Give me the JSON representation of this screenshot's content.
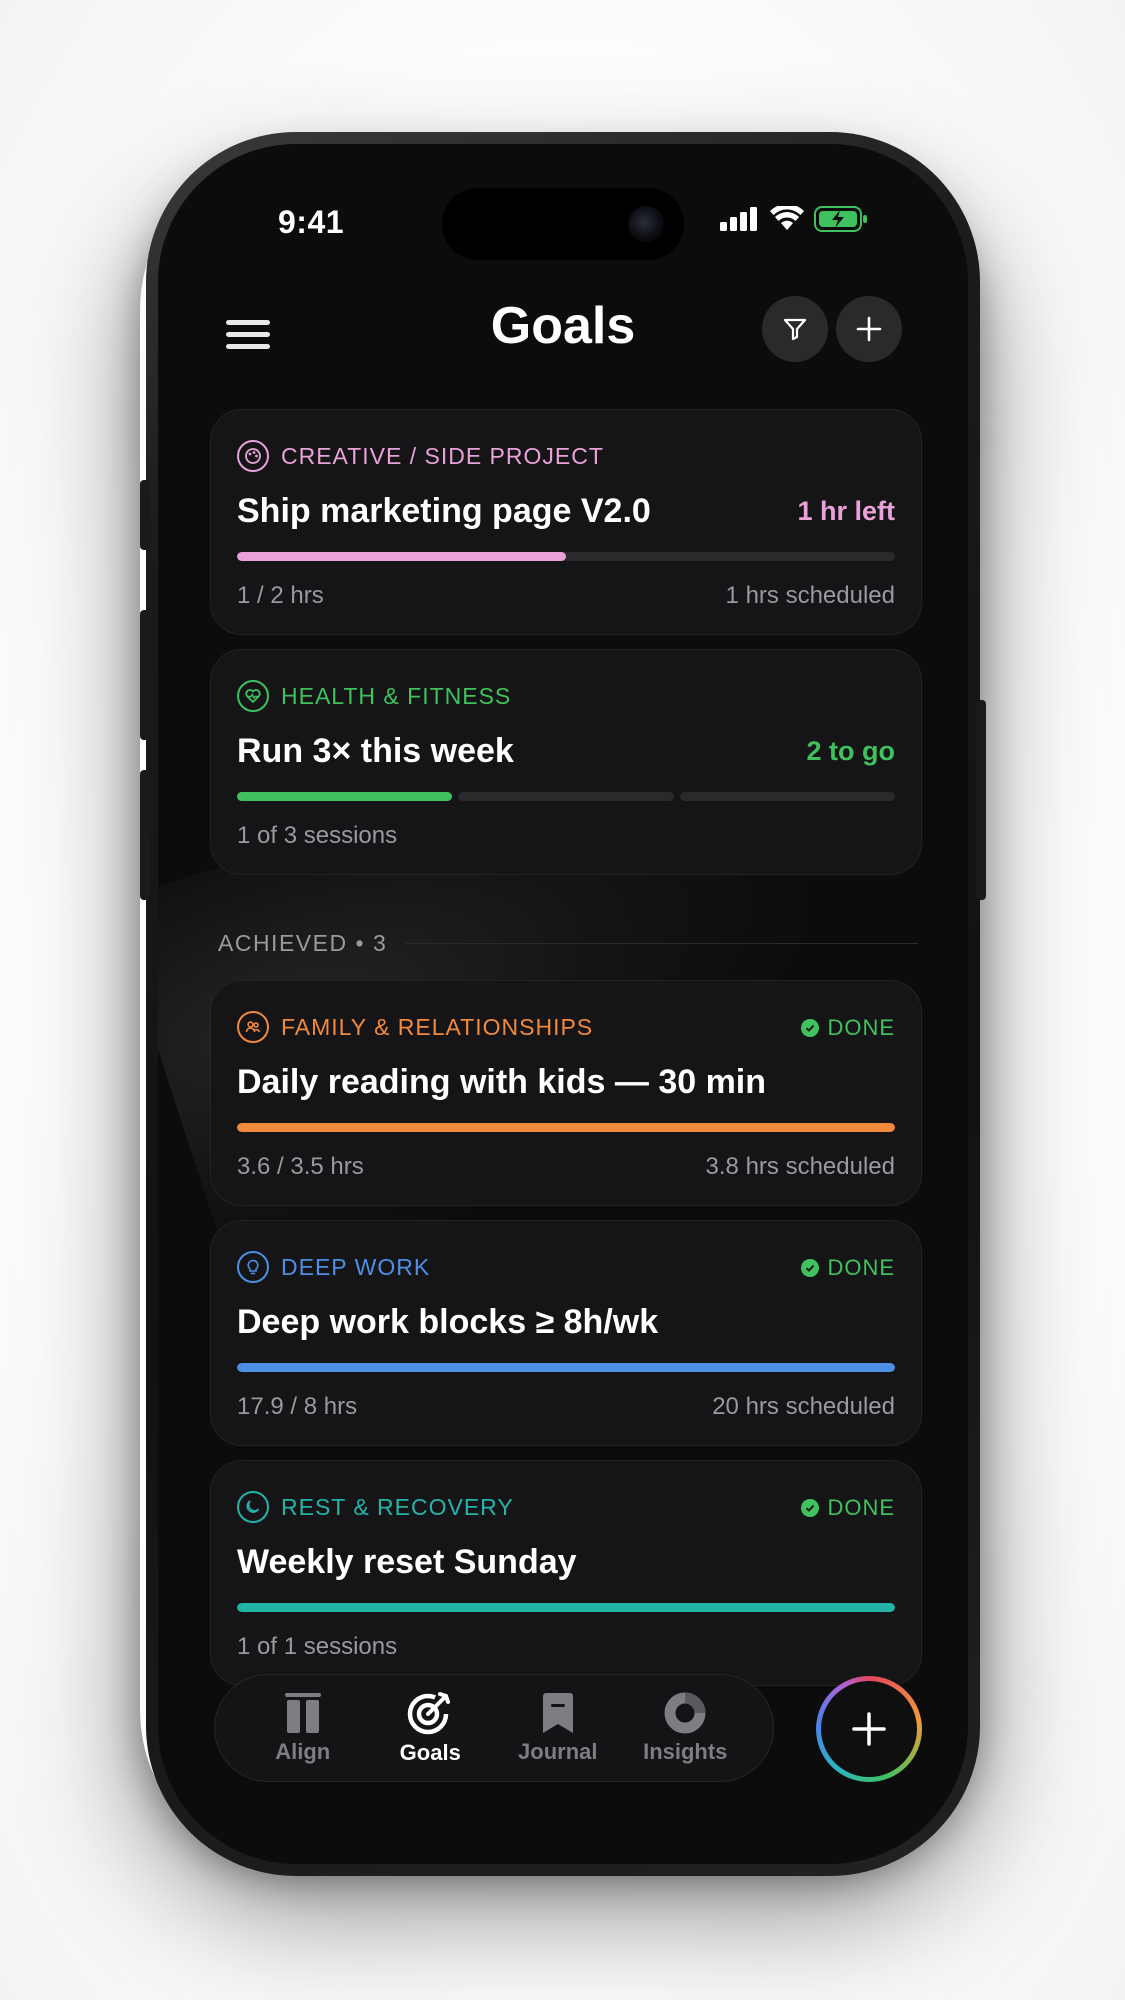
{
  "status": {
    "time": "9:41"
  },
  "header": {
    "title": "Goals",
    "menu_icon": "hamburger-icon",
    "filter_icon": "filter-icon",
    "add_icon": "plus-icon"
  },
  "active_goals": [
    {
      "category": "CREATIVE / SIDE PROJECT",
      "category_icon": "palette-icon",
      "color": "#e9a2d8",
      "title": "Ship marketing page V2.0",
      "right_label": "1 hr left",
      "progress": 0.5,
      "meta_left": "1 / 2 hrs",
      "meta_right": "1 hrs scheduled"
    },
    {
      "category": "HEALTH & FITNESS",
      "category_icon": "heart-pulse-icon",
      "color": "#3fc25e",
      "title": "Run 3× this week",
      "right_label": "2 to go",
      "sessions_done": 1,
      "sessions_total": 3,
      "meta_left": "1 of 3 sessions"
    }
  ],
  "achieved_section": {
    "label": "ACHIEVED",
    "separator": "•",
    "count": "3"
  },
  "achieved_goals": [
    {
      "category": "FAMILY & RELATIONSHIPS",
      "category_icon": "people-icon",
      "color": "#f2893b",
      "done_label": "DONE",
      "title": "Daily reading with kids — 30 min",
      "progress": 1.0,
      "meta_left": "3.6 / 3.5 hrs",
      "meta_right": "3.8 hrs scheduled"
    },
    {
      "category": "DEEP WORK",
      "category_icon": "lightbulb-icon",
      "color": "#4d8fe6",
      "done_label": "DONE",
      "title": "Deep work blocks ≥ 8h/wk",
      "progress": 1.0,
      "meta_left": "17.9 / 8 hrs",
      "meta_right": "20 hrs scheduled"
    },
    {
      "category": "REST & RECOVERY",
      "category_icon": "moon-icon",
      "color": "#24b3a8",
      "done_label": "DONE",
      "title": "Weekly reset Sunday",
      "progress": 1.0,
      "meta_left": "1 of 1 sessions"
    }
  ],
  "tabbar": {
    "tabs": [
      {
        "label": "Align",
        "icon": "align-icon",
        "active": false
      },
      {
        "label": "Goals",
        "icon": "target-icon",
        "active": true
      },
      {
        "label": "Journal",
        "icon": "bookmark-icon",
        "active": false
      },
      {
        "label": "Insights",
        "icon": "donut-icon",
        "active": false
      }
    ],
    "fab_icon": "plus-icon"
  }
}
